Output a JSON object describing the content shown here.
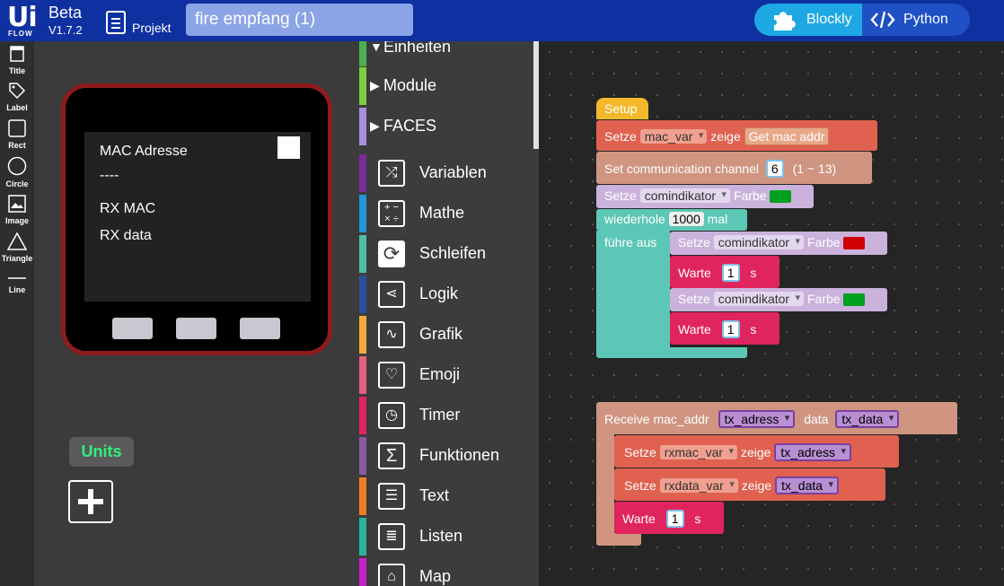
{
  "topbar": {
    "logo_ui": "Ui",
    "logo_flow": "FLOW",
    "beta": "Beta",
    "version": "V1.7.2",
    "projekt_label": "Projekt",
    "project_name": "fire empfang (1)",
    "blockly_label": "Blockly",
    "python_label": "Python"
  },
  "tools": [
    "Title",
    "Label",
    "Rect",
    "Circle",
    "Image",
    "Triangle",
    "Line"
  ],
  "screen": {
    "mac_adresse": "MAC Adresse",
    "dashes": "----",
    "rx_mac": "RX MAC",
    "rx_data": "RX data"
  },
  "units_label": "Units",
  "toolbox": {
    "cat_einheiten": "Einheiten",
    "cat_module": "Module",
    "cat_faces": "FACES",
    "items": [
      {
        "label": "Variablen",
        "color": "#7c2c9c",
        "icon": "shuffle-icon"
      },
      {
        "label": "Mathe",
        "color": "#2196d8",
        "icon": "math-icon"
      },
      {
        "label": "Schleifen",
        "color": "#4cbfa6",
        "icon": "loop-icon"
      },
      {
        "label": "Logik",
        "color": "#294f9c",
        "icon": "logic-icon"
      },
      {
        "label": "Grafik",
        "color": "#f4a93a",
        "icon": "graph-icon"
      },
      {
        "label": "Emoji",
        "color": "#e2607e",
        "icon": "heart-icon"
      },
      {
        "label": "Timer",
        "color": "#e0245e",
        "icon": "timer-icon"
      },
      {
        "label": "Funktionen",
        "color": "#8a5aa0",
        "icon": "sigma-icon"
      },
      {
        "label": "Text",
        "color": "#f07c27",
        "icon": "text-icon"
      },
      {
        "label": "Listen",
        "color": "#28b59c",
        "icon": "list-icon"
      },
      {
        "label": "Map",
        "color": "#c81ec8",
        "icon": "map-icon"
      }
    ]
  },
  "blocks": {
    "setup": "Setup",
    "setze": "Setze",
    "zeige": "zeige",
    "mac_var": "mac_var",
    "get_mac": "Get mac addr",
    "set_channel": "Set communication channel",
    "channel_val": "6",
    "channel_range": "(1 ~ 13)",
    "comindikator": "comindikator",
    "farbe": "Farbe",
    "wiederhole": "wiederhole",
    "repeat_times": "1000",
    "mal": "mal",
    "fuehre_aus": "führe aus",
    "warte": "Warte",
    "wait_val": "1",
    "s": "s",
    "receive": "Receive mac_addr",
    "tx_adress": "tx_adress",
    "data": "data",
    "tx_data": "tx_data",
    "rxmac_var": "rxmac_var",
    "rxdata_var": "rxdata_var"
  },
  "colors": {
    "green": "#00a020",
    "red": "#d00000",
    "setup": "#f5b82c",
    "var": "#e0614f",
    "rgb": "#cbb2dc",
    "loop": "#5cc7b6",
    "wait": "#e0245e",
    "espnow": "#cf9580"
  }
}
